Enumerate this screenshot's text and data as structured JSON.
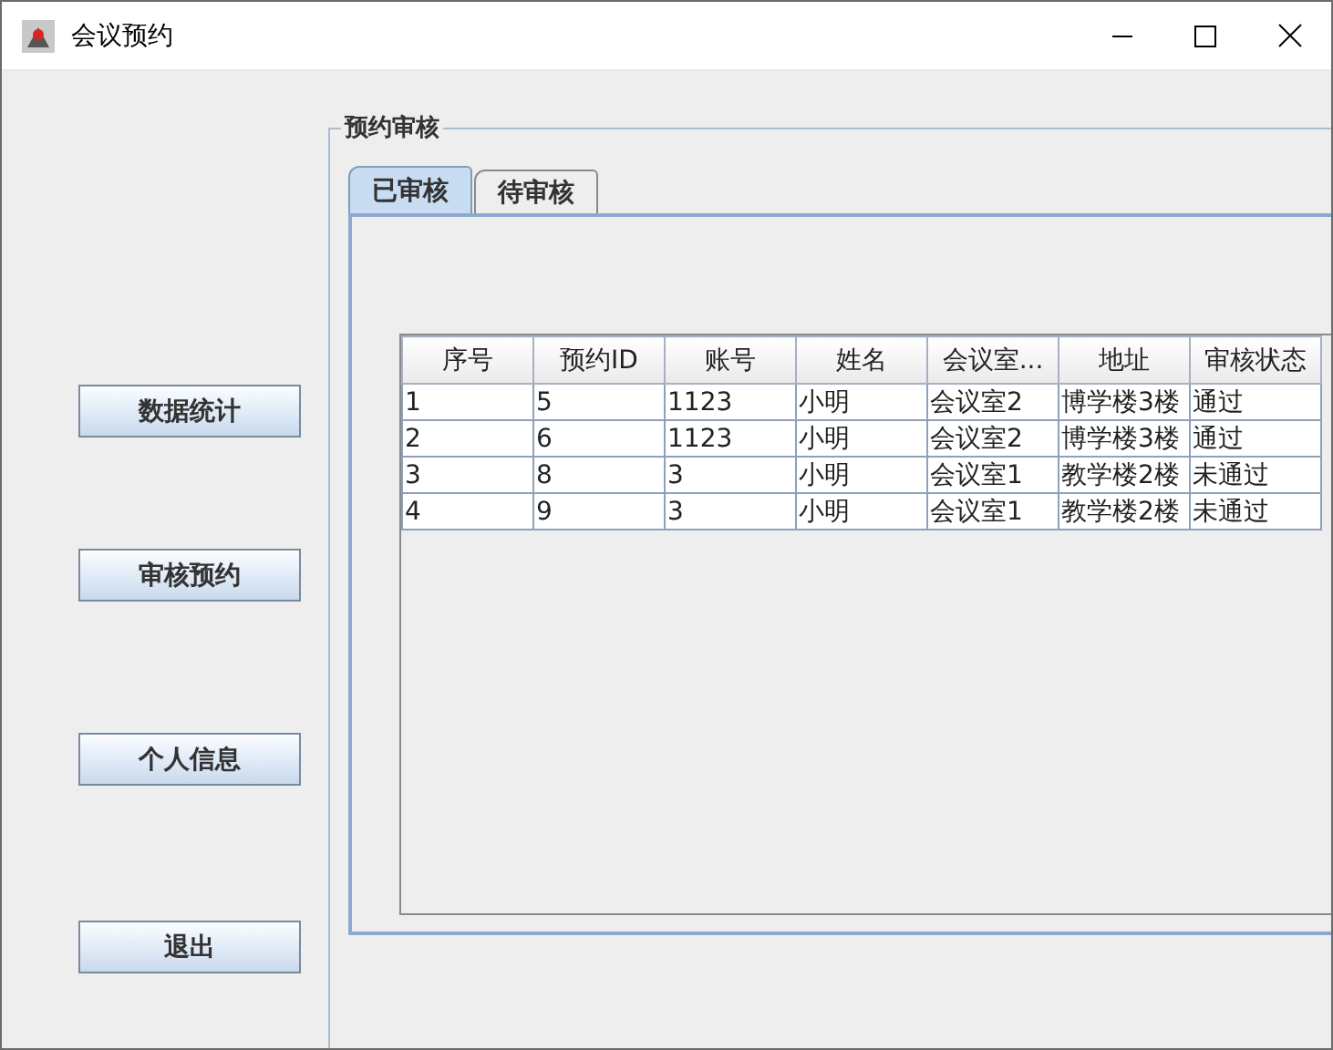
{
  "window": {
    "title": "会议预约"
  },
  "nav_buttons": [
    "数据统计",
    "审核预约",
    "个人信息",
    "退出"
  ],
  "panel": {
    "title": "预约审核",
    "tabs": [
      {
        "label": "已审核",
        "selected": true
      },
      {
        "label": "待审核",
        "selected": false
      }
    ],
    "table": {
      "columns": [
        "序号",
        "预约ID",
        "账号",
        "姓名",
        "会议室...",
        "地址",
        "审核状态"
      ],
      "rows": [
        [
          "1",
          "5",
          "1123",
          "小明",
          "会议室2",
          "博学楼3楼",
          "通过"
        ],
        [
          "2",
          "6",
          "1123",
          "小明",
          "会议室2",
          "博学楼3楼",
          "通过"
        ],
        [
          "3",
          "8",
          "3",
          "小明",
          "会议室1",
          "教学楼2楼",
          "未通过"
        ],
        [
          "4",
          "9",
          "3",
          "小明",
          "会议室1",
          "教学楼2楼",
          "未通过"
        ]
      ]
    }
  }
}
